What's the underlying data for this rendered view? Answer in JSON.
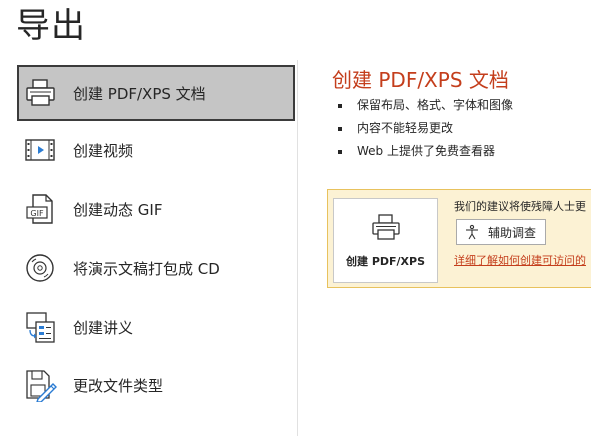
{
  "page": {
    "title": "导出"
  },
  "nav": {
    "items": [
      {
        "label": "创建 PDF/XPS 文档",
        "icon": "printer-icon",
        "selected": true
      },
      {
        "label": "创建视频",
        "icon": "video-film-icon"
      },
      {
        "label": "创建动态 GIF",
        "icon": "gif-file-icon"
      },
      {
        "label": "将演示文稿打包成 CD",
        "icon": "cd-disc-icon"
      },
      {
        "label": "创建讲义",
        "icon": "handout-icon"
      },
      {
        "label": "更改文件类型",
        "icon": "change-file-type-icon"
      }
    ]
  },
  "detail": {
    "title": "创建 PDF/XPS 文档",
    "bullets": [
      "保留布局、格式、字体和图像",
      "内容不能轻易更改",
      "Web 上提供了免费查看器"
    ],
    "panel": {
      "create_button_label": "创建 PDF/XPS",
      "text": "我们的建议将使残障人士更",
      "assist_button_label": "辅助调查",
      "link": "详细了解如何创建可访问的"
    }
  },
  "colors": {
    "accent": "#c43e1c",
    "selected_bg": "#c5c5c5",
    "panel_bg": "#fcf2d4",
    "panel_border": "#e8c25d"
  }
}
